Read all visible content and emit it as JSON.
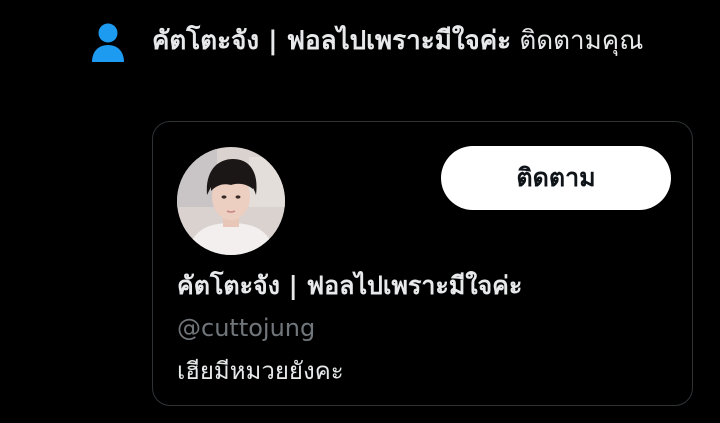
{
  "notification": {
    "icon": "person-icon",
    "actor_name": "คัตโตะจัง | ฟอลไปเพราะมีใจค่ะ",
    "action_text": "ติดตามคุณ"
  },
  "user_card": {
    "display_name": "คัตโตะจัง | ฟอลไปเพราะมีใจค่ะ",
    "handle": "@cuttojung",
    "bio": "เฮียมีหมวยยังคะ",
    "follow_label": "ติดตาม",
    "avatar_icon": "profile-photo"
  },
  "colors": {
    "background": "#000000",
    "icon_blue": "#1d9bf0",
    "text_primary": "#e7e9ea",
    "text_secondary": "#71767b",
    "button_bg": "#ffffff",
    "border": "#2f3336"
  }
}
